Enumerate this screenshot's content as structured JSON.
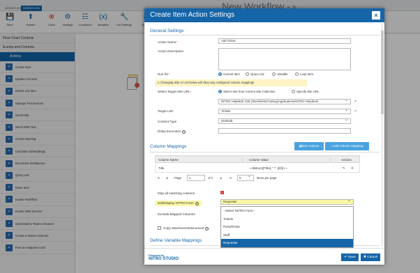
{
  "top_tabs": [
    "WORKFLOW",
    "WORKFLOW"
  ],
  "ribbon": [
    {
      "label": "Save",
      "icon": "save-icon",
      "glyph": "💾"
    },
    {
      "label": "Publish",
      "icon": "publish-icon",
      "glyph": "⬆"
    },
    {
      "label": "Close",
      "icon": "close-icon",
      "glyph": "⊗"
    },
    {
      "label": "Settings",
      "icon": "gear-icon",
      "glyph": "⚙"
    },
    {
      "label": "Conditions",
      "icon": "conditions-icon",
      "glyph": "☷"
    },
    {
      "label": "Variables",
      "icon": "variables-icon",
      "glyph": "(x)"
    },
    {
      "label": "List Settings",
      "icon": "wrench-icon",
      "glyph": "🔧"
    },
    {
      "label": "Impo",
      "icon": "import-icon",
      "glyph": "⬇"
    }
  ],
  "background_title": "New Workflow -",
  "sidebar": {
    "flow_chart": "Flow Chart Controls",
    "events": "Events and Controls",
    "actions": "Actions",
    "items": [
      "Create Item",
      "Update List Item",
      "Delete List Item",
      "Manage Permissions",
      "Send Mail",
      "Send SMS Text",
      "Create Meeting",
      "Calculate Embeddings",
      "Document Intelligence",
      "Query List",
      "Move Item",
      "Invoke Workflow",
      "Invoke Web Service",
      "Send Mail to Teams Channel",
      "Create a Teams Channel",
      "Post an Adaptive Card"
    ]
  },
  "modal": {
    "title": "Create Item Action Settings",
    "close_glyph": "×",
    "general": "General Settings",
    "action_name_label": "Action Name",
    "action_name_value": "Add Ticket",
    "action_desc_label": "Action Description",
    "run_for_label": "Run for",
    "run_for_options": [
      "Current Item",
      "Query List",
      "Variable",
      "Loop Item"
    ],
    "warning": "Changing Site or List below will clear any configured column mappings",
    "target_site_label": "Select Target Site URL",
    "site_options": [
      "Select Site from Current Site Collection",
      "Specify Site URL"
    ],
    "site_value": "NITRO Helpdesk V35 (/sites/NehaTraining/Applications/NITRO Helpdesk",
    "target_list_label": "Target List",
    "target_list_value": "Tickets",
    "content_type_label": "Content Type",
    "content_type_value": "(Default)",
    "delay_label": "Delay Execution",
    "column_mappings": "Column Mappings",
    "item_actions_btn": "Item Actions",
    "add_mapping_btn": "+Add Column Mapping",
    "col_headers": [
      "Column Name",
      "Column Value",
      "Actions"
    ],
    "row": {
      "name": "Title",
      "value": "~~$struct([Title], \"-\", [ID])~~"
    },
    "pager": {
      "page_label": "Page",
      "page": "1",
      "of": "of 1",
      "per_page": "5",
      "per_page_label": "items per page",
      "first": "⇤",
      "prev": "◂",
      "next": "▸",
      "last": "⇥"
    },
    "map_all_label": "Map all matching columns",
    "edit_form_label": "Edit/Display NITRO Form",
    "edit_form_value": "Requester",
    "exclude_label": "Exclude Mapped Columns",
    "copy_label": "Copy attachments/document",
    "define_var": "Define Variable Mappings",
    "dropdown_options": [
      "--Select NITRO Form--",
      "Tickets",
      "PortalTicket",
      "Staff",
      "Requester"
    ],
    "save": "Save",
    "cancel": "Cancel",
    "logo_small": "Powered by",
    "logo_big": "NITRO STUDIO"
  }
}
